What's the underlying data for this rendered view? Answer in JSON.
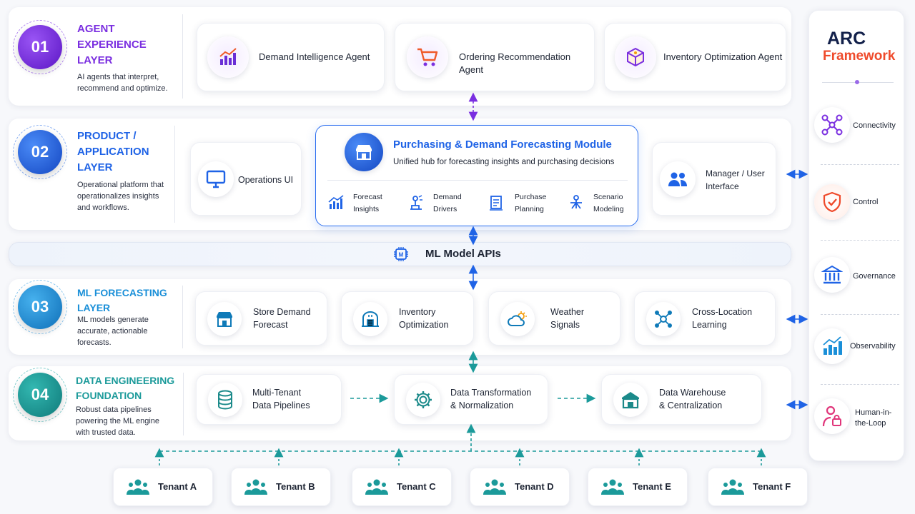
{
  "layers": [
    {
      "num": "01",
      "title": [
        "AGENT",
        "EXPERIENCE",
        "LAYER"
      ],
      "desc": [
        "AI agents that interpret,",
        "recommend and optimize."
      ],
      "color": "#7a2ee0"
    },
    {
      "num": "02",
      "title": [
        "PRODUCT /",
        "APPLICATION",
        "LAYER"
      ],
      "desc": [
        "Operational platform that",
        "operationalizes insights",
        "and workflows."
      ],
      "color": "#1f63e6"
    },
    {
      "num": "03",
      "title": [
        "ML FORECASTING",
        "LAYER"
      ],
      "desc": [
        "ML models generate",
        "accurate, actionable",
        "forecasts."
      ],
      "color": "#1a8fd8"
    },
    {
      "num": "04",
      "title": [
        "DATA ENGINEERING",
        "FOUNDATION"
      ],
      "desc": [
        "Robust data pipelines",
        "powering the ML engine",
        "with trusted data."
      ],
      "color": "#1b9a9a"
    }
  ],
  "agents": [
    "Demand Intelligence Agent",
    "Ordering Recommendation Agent",
    "Inventory Optimization Agent"
  ],
  "product": {
    "operations_ui": "Operations UI",
    "module_title": "Purchasing & Demand Forecasting Module",
    "module_sub": "Unified hub for forecasting insights and purchasing decisions",
    "features": [
      [
        "Forecast",
        "Insights"
      ],
      [
        "Demand",
        "Drivers"
      ],
      [
        "Purchase",
        "Planning"
      ],
      [
        "Scenario",
        "Modeling"
      ]
    ],
    "manager": [
      "Manager / User",
      "Interface"
    ]
  },
  "api_label": "ML Model APIs",
  "ml_cards": [
    [
      "Store Demand",
      "Forecast"
    ],
    [
      "Inventory",
      "Optimization"
    ],
    [
      "Weather",
      "Signals"
    ],
    [
      "Cross-Location",
      "Learning"
    ]
  ],
  "data_cards": [
    [
      "Multi-Tenant",
      "Data Pipelines"
    ],
    [
      "Data Transformation",
      "& Normalization"
    ],
    [
      "Data Warehouse",
      "& Centralization"
    ]
  ],
  "tenants": [
    "Tenant A",
    "Tenant B",
    "Tenant C",
    "Tenant D",
    "Tenant E",
    "Tenant F"
  ],
  "arc": {
    "title1": "ARC",
    "title2": "Framework",
    "items": [
      "Connectivity",
      "Control",
      "Governance",
      "Observability",
      [
        "Human-in-",
        "the-Loop"
      ]
    ]
  },
  "colors": {
    "purple": "#7a2ee0",
    "blue": "#1f63e6",
    "teal": "#1b9a9a",
    "orange": "#f0561e",
    "arc_red": "#ef4a2b",
    "pink": "#e0357a"
  }
}
